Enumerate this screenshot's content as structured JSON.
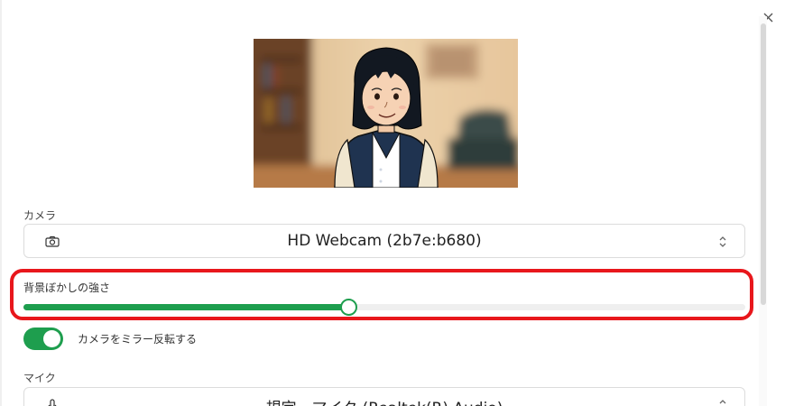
{
  "camera": {
    "label": "カメラ",
    "selected": "HD Webcam (2b7e:b680)",
    "icon": "camera-icon"
  },
  "blur": {
    "label": "背景ぼかしの強さ",
    "value_fraction": 0.45,
    "accent_color": "#1e9e4e"
  },
  "mirror": {
    "label": "カメラをミラー反転する",
    "enabled": true
  },
  "mic": {
    "label": "マイク",
    "selected": "規定 - マイク (Realtek(R) Audio)",
    "icon": "microphone-icon"
  },
  "highlight_color": "#e8171c"
}
